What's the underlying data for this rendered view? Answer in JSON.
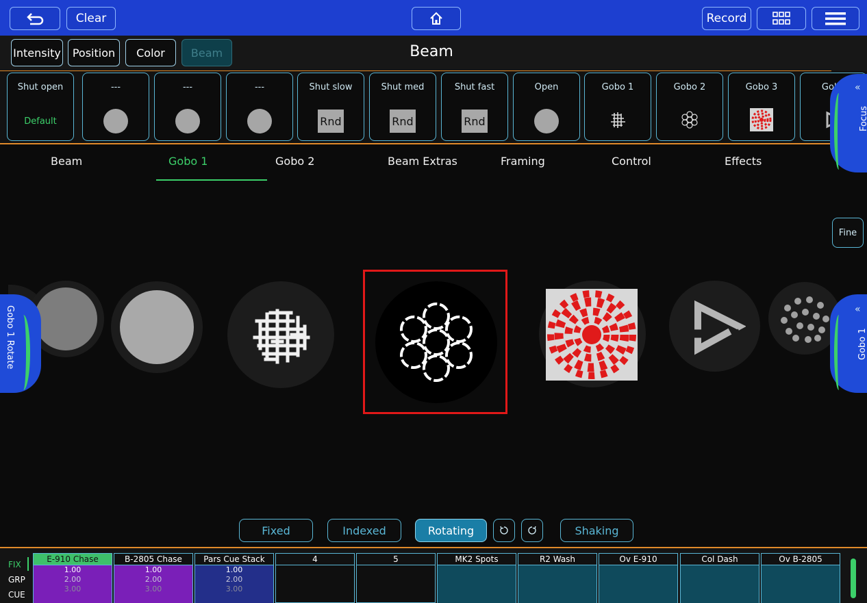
{
  "topbar": {
    "clear_label": "Clear",
    "record_label": "Record",
    "back_icon": "undo-icon",
    "home_icon": "home-icon",
    "grid_icon": "grid-icon",
    "menu_icon": "menu-icon"
  },
  "attributes": {
    "intensity": "Intensity",
    "position": "Position",
    "color": "Color",
    "beam": "Beam"
  },
  "page_title": "Beam",
  "palettes": [
    {
      "label": "Shut open",
      "value": "Default",
      "kind": "text"
    },
    {
      "label": "---",
      "kind": "dot"
    },
    {
      "label": "---",
      "kind": "dot"
    },
    {
      "label": "---",
      "kind": "dot"
    },
    {
      "label": "Shut slow",
      "value": "Rnd",
      "kind": "rnd"
    },
    {
      "label": "Shut med",
      "value": "Rnd",
      "kind": "rnd"
    },
    {
      "label": "Shut fast",
      "value": "Rnd",
      "kind": "rnd"
    },
    {
      "label": "Open",
      "kind": "dot"
    },
    {
      "label": "Gobo 1",
      "kind": "gobo-maze"
    },
    {
      "label": "Gobo 2",
      "kind": "gobo-rings"
    },
    {
      "label": "Gobo 3",
      "kind": "gobo-checker"
    },
    {
      "label": "Gobo",
      "kind": "gobo-triangle"
    }
  ],
  "tabs": [
    "Beam",
    "Gobo 1",
    "Gobo 2",
    "Beam Extras",
    "Framing",
    "Control",
    "Effects"
  ],
  "active_tab": "Gobo 1",
  "side_handles": {
    "focus": "Focus",
    "gobo1": "Gobo 1",
    "gobo1_rotate": "Gobo 1 Rotate"
  },
  "fine_label": "Fine",
  "modes": {
    "fixed": "Fixed",
    "indexed": "Indexed",
    "rotating": "Rotating",
    "shaking": "Shaking"
  },
  "playback_side": [
    "FIX",
    "GRP",
    "CUE"
  ],
  "playbacks": [
    {
      "name": "E-910 Chase",
      "v1": "1.00",
      "v2": "2.00",
      "v3": "3.00"
    },
    {
      "name": "B-2805 Chase",
      "v1": "1.00",
      "v2": "2.00",
      "v3": "3.00"
    },
    {
      "name": "Pars Cue Stack",
      "v1": "1.00",
      "v2": "2.00",
      "v3": "3.00"
    },
    {
      "name": "4"
    },
    {
      "name": "5"
    },
    {
      "name": "MK2 Spots"
    },
    {
      "name": "R2 Wash"
    },
    {
      "name": "Ov E-910"
    },
    {
      "name": "Col Dash"
    },
    {
      "name": "Ov B-2805"
    }
  ],
  "colors": {
    "topbar": "#1d3fd0",
    "accent_green": "#3cd06a",
    "accent_cyan": "#5ab7d6",
    "selection_red": "#e01818"
  }
}
